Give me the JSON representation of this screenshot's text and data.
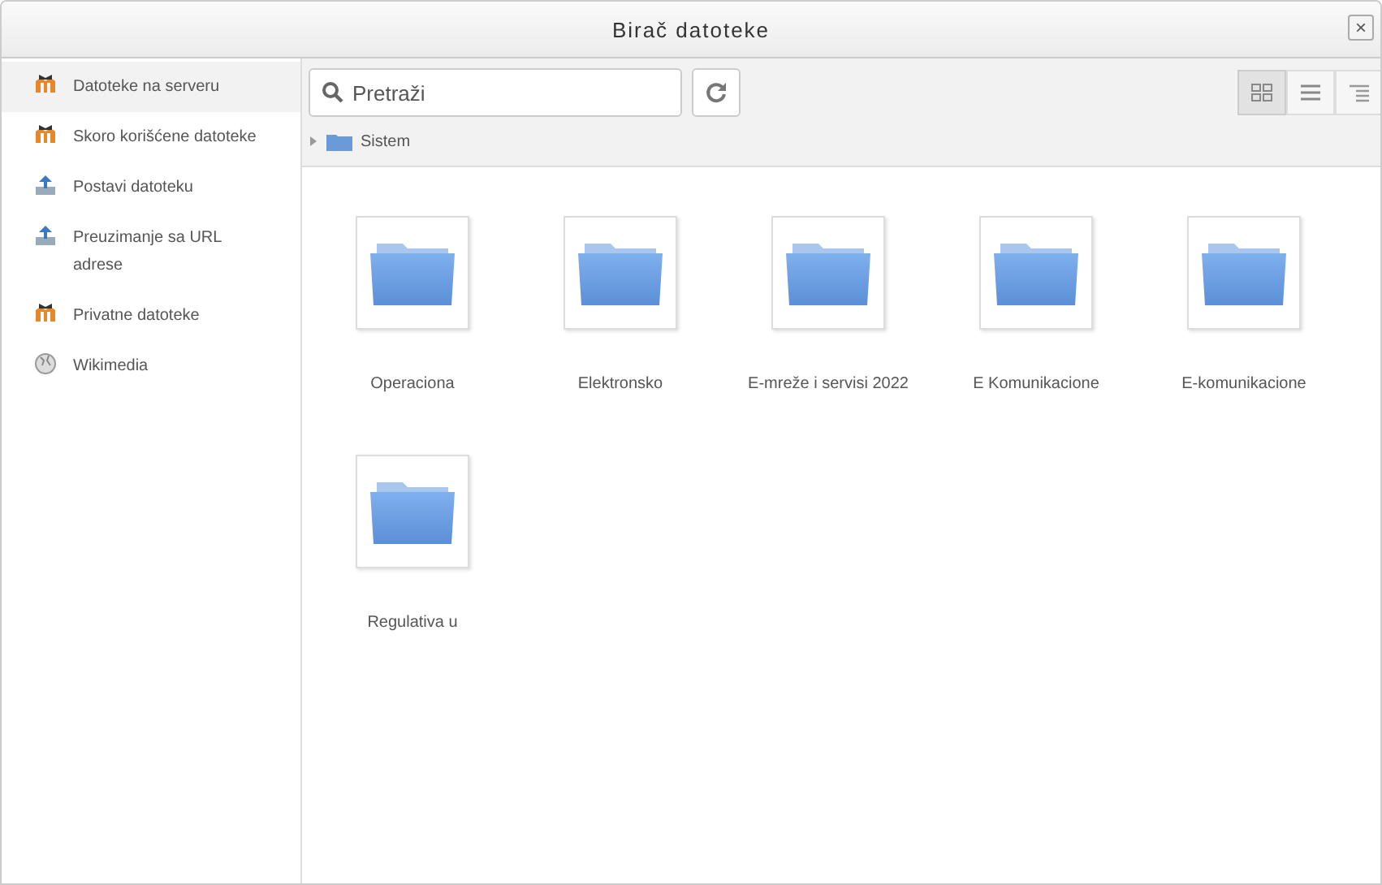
{
  "window": {
    "title": "Birač datoteke",
    "close": "×"
  },
  "sidebar": {
    "items": [
      {
        "label": "Datoteke na serveru",
        "kind": "repository",
        "selected": true
      },
      {
        "label": "Skoro korišćene datoteke",
        "kind": "repository",
        "selected": false
      },
      {
        "label": "Postavi datoteku",
        "kind": "upload",
        "selected": false
      },
      {
        "label": "Preuzimanje sa URL adrese",
        "kind": "upload",
        "selected": false
      },
      {
        "label": "Privatne datoteke",
        "kind": "repository",
        "selected": false
      },
      {
        "label": "Wikimedia",
        "kind": "globe",
        "selected": false
      }
    ]
  },
  "toolbar": {
    "search": {
      "placeholder": "Pretraži"
    },
    "views": [
      {
        "kind": "icons",
        "selected": true
      },
      {
        "kind": "list",
        "selected": false
      },
      {
        "kind": "tree",
        "selected": false
      }
    ]
  },
  "breadcrumb": {
    "path": "Sistem"
  },
  "folders": [
    {
      "name": "Operaciona"
    },
    {
      "name": "Elektronsko"
    },
    {
      "name": "E-mreže i servisi 2022"
    },
    {
      "name": "E Komunikacione"
    },
    {
      "name": "E-komunikacione"
    },
    {
      "name": "Regulativa u"
    }
  ]
}
